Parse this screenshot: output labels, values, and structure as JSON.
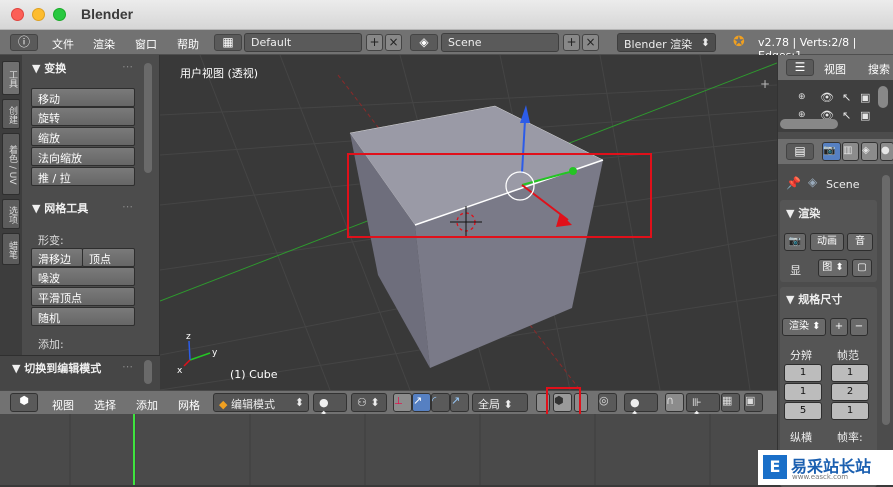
{
  "window": {
    "title": "Blender"
  },
  "topbar": {
    "menus": [
      "文件",
      "渲染",
      "窗口",
      "帮助"
    ],
    "layout": "Default",
    "scene": "Scene",
    "engine": "Blender 渲染",
    "stats": "v2.78 | Verts:2/8 | Edges:1"
  },
  "toolshelf": {
    "tabs": [
      "工具",
      "创建",
      "着色 / UV",
      "选项",
      "蜡笔"
    ],
    "transform_title": "▼ 变换",
    "transform_buttons": [
      "移动",
      "旋转",
      "缩放",
      "法向缩放",
      "推 / 拉"
    ],
    "mesh_title": "▼ 网格工具",
    "deform_label": "形变:",
    "slide_edge": "滑移边",
    "slide_vertex": "顶点",
    "mesh_buttons": [
      "噪波",
      "平滑顶点",
      "随机"
    ],
    "add_label": "添加:",
    "operator_title": "▼ 切换到编辑模式"
  },
  "viewport": {
    "label": "用户视图 (透视)",
    "object_label": "(1) Cube",
    "axis_labels": {
      "x": "x",
      "y": "y",
      "z": "z"
    }
  },
  "bottombar": {
    "menus": [
      "视图",
      "选择",
      "添加",
      "网格"
    ],
    "mode": "编辑模式",
    "orientation": "全局"
  },
  "outliner": {
    "view": "视图",
    "search": "搜索"
  },
  "properties": {
    "scene_item": "Scene",
    "render_title": "▼ 渲染",
    "render_btn": "渲染",
    "anim_btn": "动画",
    "audio_btn": "音",
    "display_label": "显",
    "display_value": "图",
    "dimensions_title": "▼ 规格尺寸",
    "preset": "渲染",
    "resolution_label": "分辨",
    "frame_range_label": "帧范",
    "res_x": "1",
    "res_y": "1",
    "res_pct": "5",
    "frame_start": "1",
    "frame_end": "2",
    "frame_step": "1",
    "aspect_label": "纵横",
    "fps_label": "帧率:"
  },
  "watermark": {
    "text": "易采站长站",
    "sub": "www.easck.com"
  },
  "colors": {
    "accent": "#5680c2",
    "annotation": "#e0101a",
    "x_axis": "#e0101a",
    "y_axis": "#24c424",
    "z_axis": "#2c5ce8"
  }
}
